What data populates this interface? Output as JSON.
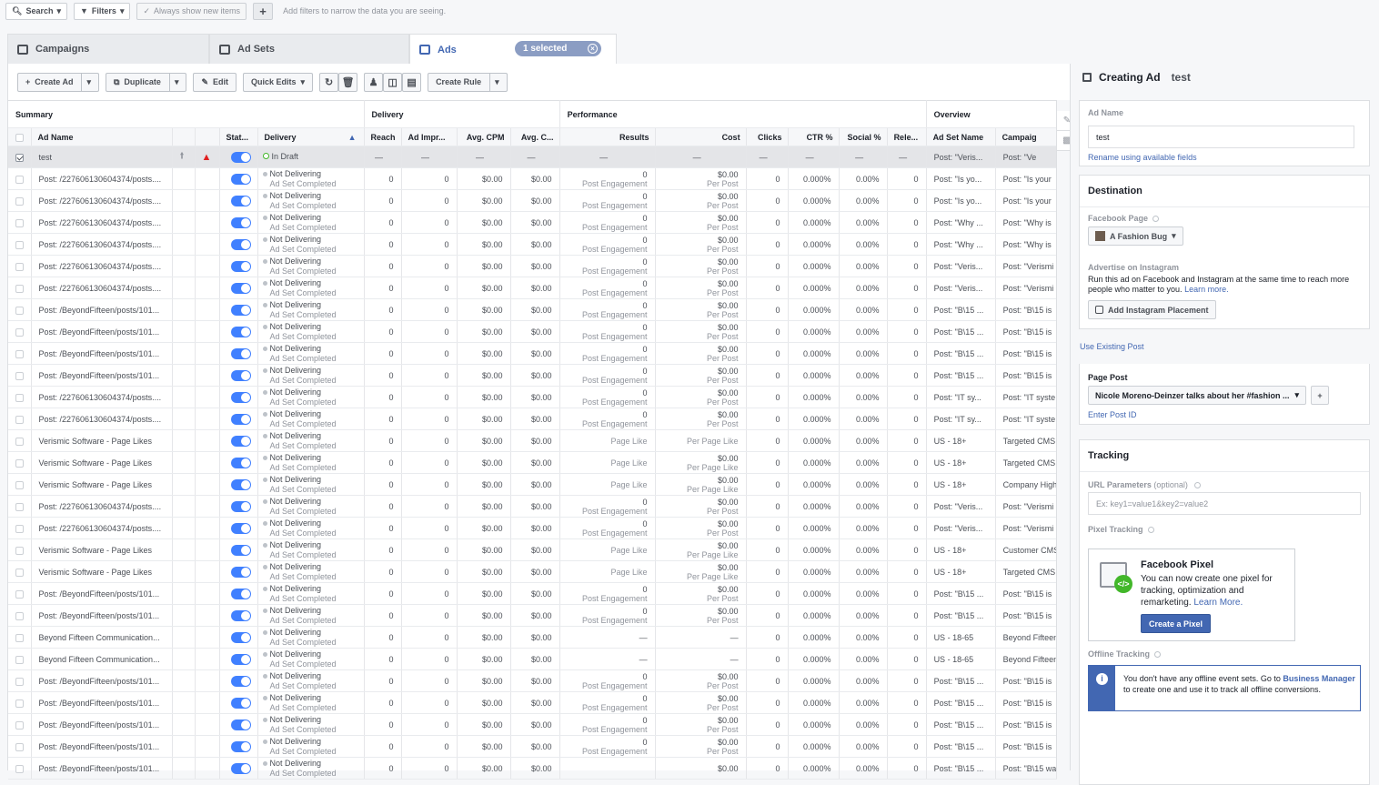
{
  "filterbar": {
    "search": "Search",
    "filters": "Filters",
    "always_show": "Always show new items",
    "plus": "+",
    "hint": "Add filters to narrow the data you are seeing."
  },
  "tabs": {
    "campaigns": "Campaigns",
    "adsets": "Ad Sets",
    "ads": "Ads",
    "selected": "1 selected"
  },
  "toolbar": {
    "create_ad": "Create Ad",
    "duplicate": "Duplicate",
    "edit": "Edit",
    "quick_edits": "Quick Edits",
    "create_rule": "Create Rule"
  },
  "groups": {
    "summary": "Summary",
    "delivery": "Delivery",
    "performance": "Performance",
    "overview": "Overview"
  },
  "columns": {
    "ad_name": "Ad Name",
    "status": "Stat...",
    "delivery": "Delivery",
    "reach": "Reach",
    "impr": "Ad Impr...",
    "cpm": "Avg. CPM",
    "cpc": "Avg. C...",
    "results": "Results",
    "cost": "Cost",
    "clicks": "Clicks",
    "ctr": "CTR %",
    "social": "Social %",
    "rel": "Rele...",
    "adset": "Ad Set Name",
    "campaign": "Campaig"
  },
  "draft_row": {
    "name": "test",
    "delivery": "In Draft",
    "dash": "—",
    "adset": "Post: \"Veris...",
    "campaign": "Post: \"Ve"
  },
  "rows": [
    {
      "name": "Post: /227606130604374/posts....",
      "rnum": "0",
      "rsub": "Post Engagement",
      "cost": "$0.00",
      "csub": "Per Post",
      "adset": "Post: \"Is yo...",
      "camp": "Post: \"Is your"
    },
    {
      "name": "Post: /227606130604374/posts....",
      "rnum": "0",
      "rsub": "Post Engagement",
      "cost": "$0.00",
      "csub": "Per Post",
      "adset": "Post: \"Is yo...",
      "camp": "Post: \"Is your"
    },
    {
      "name": "Post: /227606130604374/posts....",
      "rnum": "0",
      "rsub": "Post Engagement",
      "cost": "$0.00",
      "csub": "Per Post",
      "adset": "Post: \"Why ...",
      "camp": "Post: \"Why is"
    },
    {
      "name": "Post: /227606130604374/posts....",
      "rnum": "0",
      "rsub": "Post Engagement",
      "cost": "$0.00",
      "csub": "Per Post",
      "adset": "Post: \"Why ...",
      "camp": "Post: \"Why is"
    },
    {
      "name": "Post: /227606130604374/posts....",
      "rnum": "0",
      "rsub": "Post Engagement",
      "cost": "$0.00",
      "csub": "Per Post",
      "adset": "Post: \"Veris...",
      "camp": "Post: \"Verismi"
    },
    {
      "name": "Post: /227606130604374/posts....",
      "rnum": "0",
      "rsub": "Post Engagement",
      "cost": "$0.00",
      "csub": "Per Post",
      "adset": "Post: \"Veris...",
      "camp": "Post: \"Verismi"
    },
    {
      "name": "Post: /BeyondFifteen/posts/101...",
      "rnum": "0",
      "rsub": "Post Engagement",
      "cost": "$0.00",
      "csub": "Per Post",
      "adset": "Post: \"B\\15 ...",
      "camp": "Post: \"B\\15 is"
    },
    {
      "name": "Post: /BeyondFifteen/posts/101...",
      "rnum": "0",
      "rsub": "Post Engagement",
      "cost": "$0.00",
      "csub": "Per Post",
      "adset": "Post: \"B\\15 ...",
      "camp": "Post: \"B\\15 is"
    },
    {
      "name": "Post: /BeyondFifteen/posts/101...",
      "rnum": "0",
      "rsub": "Post Engagement",
      "cost": "$0.00",
      "csub": "Per Post",
      "adset": "Post: \"B\\15 ...",
      "camp": "Post: \"B\\15 is"
    },
    {
      "name": "Post: /BeyondFifteen/posts/101...",
      "rnum": "0",
      "rsub": "Post Engagement",
      "cost": "$0.00",
      "csub": "Per Post",
      "adset": "Post: \"B\\15 ...",
      "camp": "Post: \"B\\15 is"
    },
    {
      "name": "Post: /227606130604374/posts....",
      "rnum": "0",
      "rsub": "Post Engagement",
      "cost": "$0.00",
      "csub": "Per Post",
      "adset": "Post: \"IT sy...",
      "camp": "Post: \"IT syste"
    },
    {
      "name": "Post: /227606130604374/posts....",
      "rnum": "0",
      "rsub": "Post Engagement",
      "cost": "$0.00",
      "csub": "Per Post",
      "adset": "Post: \"IT sy...",
      "camp": "Post: \"IT syste"
    },
    {
      "name": "Verismic Software - Page Likes",
      "rnum": "",
      "rsub": "Page Like",
      "cost": "",
      "csub": "Per Page Like",
      "adset": "US - 18+",
      "camp": "Targeted CMS"
    },
    {
      "name": "Verismic Software - Page Likes",
      "rnum": "",
      "rsub": "Page Like",
      "cost": "$0.00",
      "csub": "Per Page Like",
      "adset": "US - 18+",
      "camp": "Targeted CMS"
    },
    {
      "name": "Verismic Software - Page Likes",
      "rnum": "",
      "rsub": "Page Like",
      "cost": "$0.00",
      "csub": "Per Page Like",
      "adset": "US - 18+",
      "camp": "Company High"
    },
    {
      "name": "Post: /227606130604374/posts....",
      "rnum": "0",
      "rsub": "Post Engagement",
      "cost": "$0.00",
      "csub": "Per Post",
      "adset": "Post: \"Veris...",
      "camp": "Post: \"Verismi"
    },
    {
      "name": "Post: /227606130604374/posts....",
      "rnum": "0",
      "rsub": "Post Engagement",
      "cost": "$0.00",
      "csub": "Per Post",
      "adset": "Post: \"Veris...",
      "camp": "Post: \"Verismi"
    },
    {
      "name": "Verismic Software - Page Likes",
      "rnum": "",
      "rsub": "Page Like",
      "cost": "$0.00",
      "csub": "Per Page Like",
      "adset": "US - 18+",
      "camp": "Customer CMS"
    },
    {
      "name": "Verismic Software - Page Likes",
      "rnum": "",
      "rsub": "Page Like",
      "cost": "$0.00",
      "csub": "Per Page Like",
      "adset": "US - 18+",
      "camp": "Targeted CMS"
    },
    {
      "name": "Post: /BeyondFifteen/posts/101...",
      "rnum": "0",
      "rsub": "Post Engagement",
      "cost": "$0.00",
      "csub": "Per Post",
      "adset": "Post: \"B\\15 ...",
      "camp": "Post: \"B\\15 is"
    },
    {
      "name": "Post: /BeyondFifteen/posts/101...",
      "rnum": "0",
      "rsub": "Post Engagement",
      "cost": "$0.00",
      "csub": "Per Post",
      "adset": "Post: \"B\\15 ...",
      "camp": "Post: \"B\\15 is"
    },
    {
      "name": "Beyond Fifteen Communication...",
      "rnum": "—",
      "rsub": "",
      "cost": "—",
      "csub": "",
      "adset": "US - 18-65",
      "camp": "Beyond Fifteen"
    },
    {
      "name": "Beyond Fifteen Communication...",
      "rnum": "—",
      "rsub": "",
      "cost": "—",
      "csub": "",
      "adset": "US - 18-65",
      "camp": "Beyond Fifteen"
    },
    {
      "name": "Post: /BeyondFifteen/posts/101...",
      "rnum": "0",
      "rsub": "Post Engagement",
      "cost": "$0.00",
      "csub": "Per Post",
      "adset": "Post: \"B\\15 ...",
      "camp": "Post: \"B\\15 is"
    },
    {
      "name": "Post: /BeyondFifteen/posts/101...",
      "rnum": "0",
      "rsub": "Post Engagement",
      "cost": "$0.00",
      "csub": "Per Post",
      "adset": "Post: \"B\\15 ...",
      "camp": "Post: \"B\\15 is"
    },
    {
      "name": "Post: /BeyondFifteen/posts/101...",
      "rnum": "0",
      "rsub": "Post Engagement",
      "cost": "$0.00",
      "csub": "Per Post",
      "adset": "Post: \"B\\15 ...",
      "camp": "Post: \"B\\15 is"
    },
    {
      "name": "Post: /BeyondFifteen/posts/101...",
      "rnum": "0",
      "rsub": "Post Engagement",
      "cost": "$0.00",
      "csub": "Per Post",
      "adset": "Post: \"B\\15 ...",
      "camp": "Post: \"B\\15 is"
    },
    {
      "name": "Post: /BeyondFifteen/posts/101...",
      "rnum": "",
      "rsub": "",
      "cost": "$0.00",
      "csub": "",
      "adset": "Post: \"B\\15 ...",
      "camp": "Post: \"B\\15 wa"
    }
  ],
  "row_defaults": {
    "deliv1": "Not Delivering",
    "deliv2": "Ad Set Completed",
    "zero": "0",
    "money": "$0.00",
    "ctr": "0.000%",
    "social": "0.00%"
  },
  "panel": {
    "title": "Creating Ad",
    "ad_title_name": "test",
    "ad_name_label": "Ad Name",
    "ad_name_value": "test",
    "rename_link": "Rename using available fields",
    "destination": "Destination",
    "fb_page_label": "Facebook Page",
    "fb_page_value": "A Fashion Bug",
    "advertise_ig": "Advertise on Instagram",
    "ig_text": "Run this ad on Facebook and Instagram at the same time to reach more people who matter to you.",
    "learn_more": "Learn more.",
    "add_ig": "Add Instagram Placement",
    "use_existing": "Use Existing Post",
    "page_post_label": "Page Post",
    "page_post_value": "Nicole Moreno-Deinzer talks about her #fashion ...",
    "enter_post_id": "Enter Post ID",
    "tracking": "Tracking",
    "url_params_label": "URL Parameters",
    "url_params_optional": "(optional)",
    "url_params_placeholder": "Ex: key1=value1&key2=value2",
    "pixel_tracking": "Pixel Tracking",
    "fb_pixel_title": "Facebook Pixel",
    "fb_pixel_text": "You can now create one pixel for tracking, optimization and remarketing.",
    "fb_pixel_learn": "Learn More.",
    "create_pixel": "Create a Pixel",
    "offline_tracking": "Offline Tracking",
    "offline_text_1": "You don't have any offline event sets. Go to",
    "offline_link": "Business Manager",
    "offline_text_2": "to create one and use it to track all offline conversions."
  }
}
